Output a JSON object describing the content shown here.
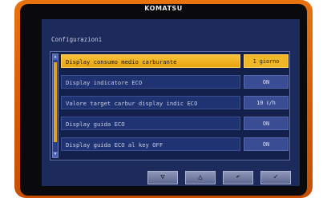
{
  "brand": "KOMATSU",
  "screen": {
    "title": "Configurazioni",
    "rows": [
      {
        "label": "Display consumo medio carburante",
        "value": "1 giorno",
        "selected": true
      },
      {
        "label": "Display indicatore ECO",
        "value": "ON"
      },
      {
        "label": "Valore target carbur display indic ECO",
        "value": "10  ℓ/h"
      },
      {
        "label": "Display guida ECO",
        "value": "ON"
      },
      {
        "label": "Display guida ECO al key OFF",
        "value": "ON"
      }
    ]
  },
  "buttons": [
    {
      "name": "down-button",
      "icon": "down-triangle-icon",
      "glyph": "▽"
    },
    {
      "name": "up-button",
      "icon": "up-triangle-icon",
      "glyph": "△"
    },
    {
      "name": "back-button",
      "icon": "return-arrow-icon",
      "glyph": "↶"
    },
    {
      "name": "confirm-button",
      "icon": "checkmark-icon",
      "glyph": "✓"
    }
  ],
  "colors": {
    "bezel": "#d65a05",
    "screen_bg": "#1d2b5c",
    "selection": "#f0b828"
  }
}
